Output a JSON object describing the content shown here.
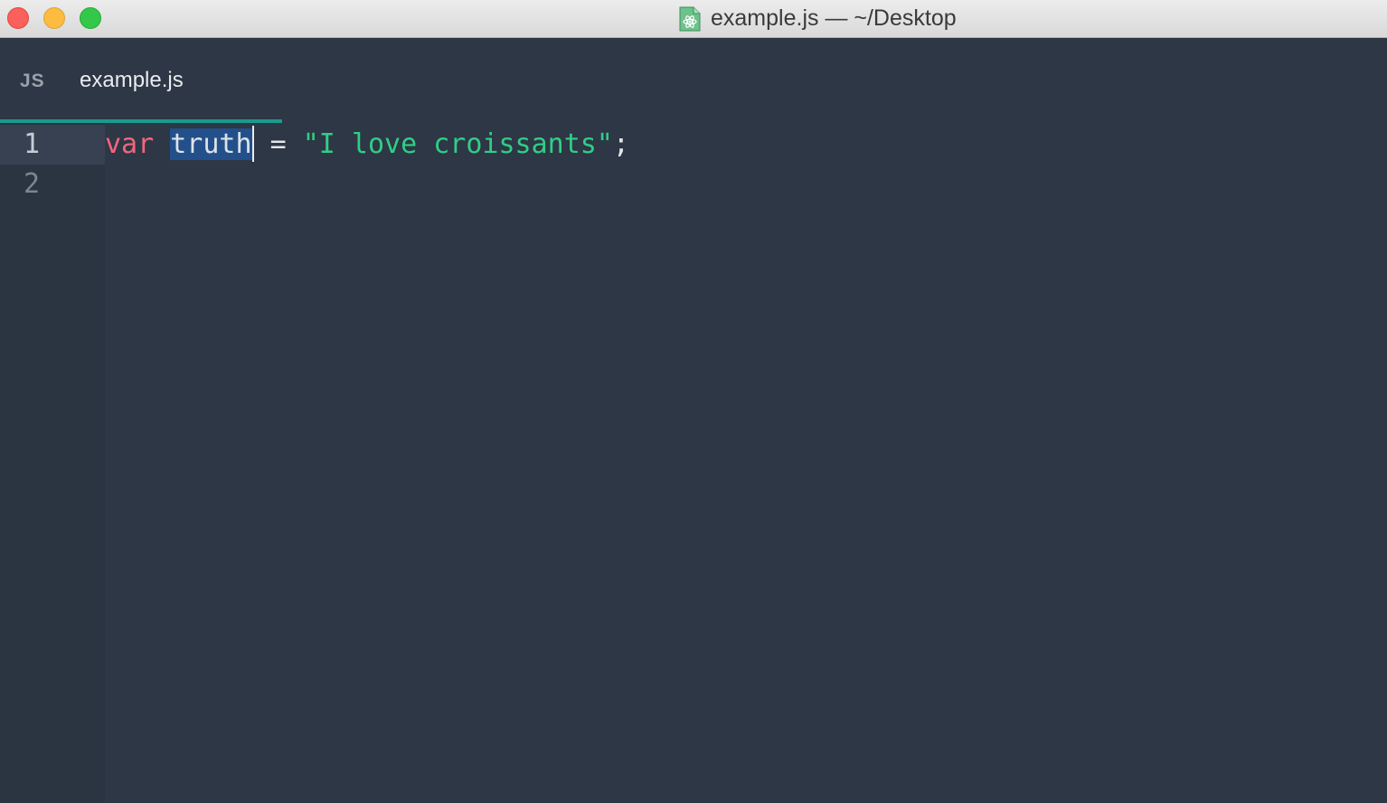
{
  "window": {
    "title": "example.js — ~/Desktop",
    "doc_icon": "atom-document-icon",
    "traffic_lights": [
      "close",
      "minimize",
      "zoom"
    ]
  },
  "tabs": [
    {
      "lang_label": "JS",
      "title": "example.js",
      "active": true
    }
  ],
  "editor": {
    "line_numbers": [
      "1",
      "2"
    ],
    "lines": [
      {
        "tokens": {
          "keyword": "var",
          "space1": " ",
          "identifier": "truth",
          "space2": " ",
          "operator": "=",
          "space3": " ",
          "string": "\"I love croissants\"",
          "punct": ";"
        }
      },
      {
        "tokens": {}
      }
    ],
    "selection": "truth"
  },
  "colors": {
    "background": "#2e3745",
    "gutter": "#2b3441",
    "keyword": "#f2667e",
    "string": "#2fcf86",
    "selection": "#23508a",
    "tab_accent": "#1a9a8e"
  }
}
